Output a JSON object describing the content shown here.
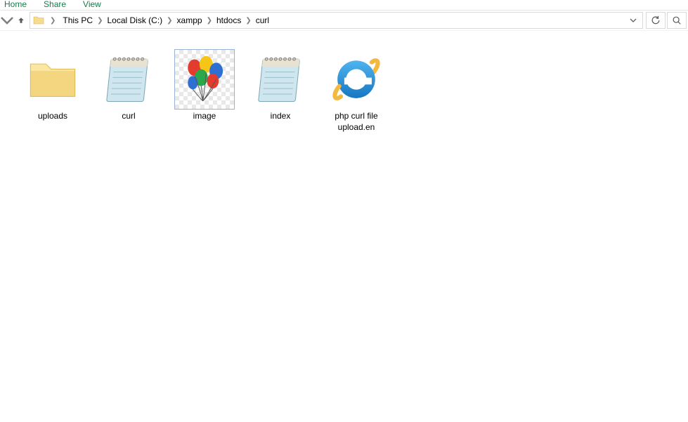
{
  "ribbon": {
    "tabs": [
      "Home",
      "Share",
      "View"
    ]
  },
  "breadcrumb": {
    "segments": [
      "This PC",
      "Local Disk (C:)",
      "xampp",
      "htdocs",
      "curl"
    ]
  },
  "items": [
    {
      "name": "uploads",
      "type": "folder"
    },
    {
      "name": "curl",
      "type": "notepad"
    },
    {
      "name": "image",
      "type": "image"
    },
    {
      "name": "index",
      "type": "notepad"
    },
    {
      "name": "php curl file upload.en",
      "type": "ie"
    }
  ]
}
